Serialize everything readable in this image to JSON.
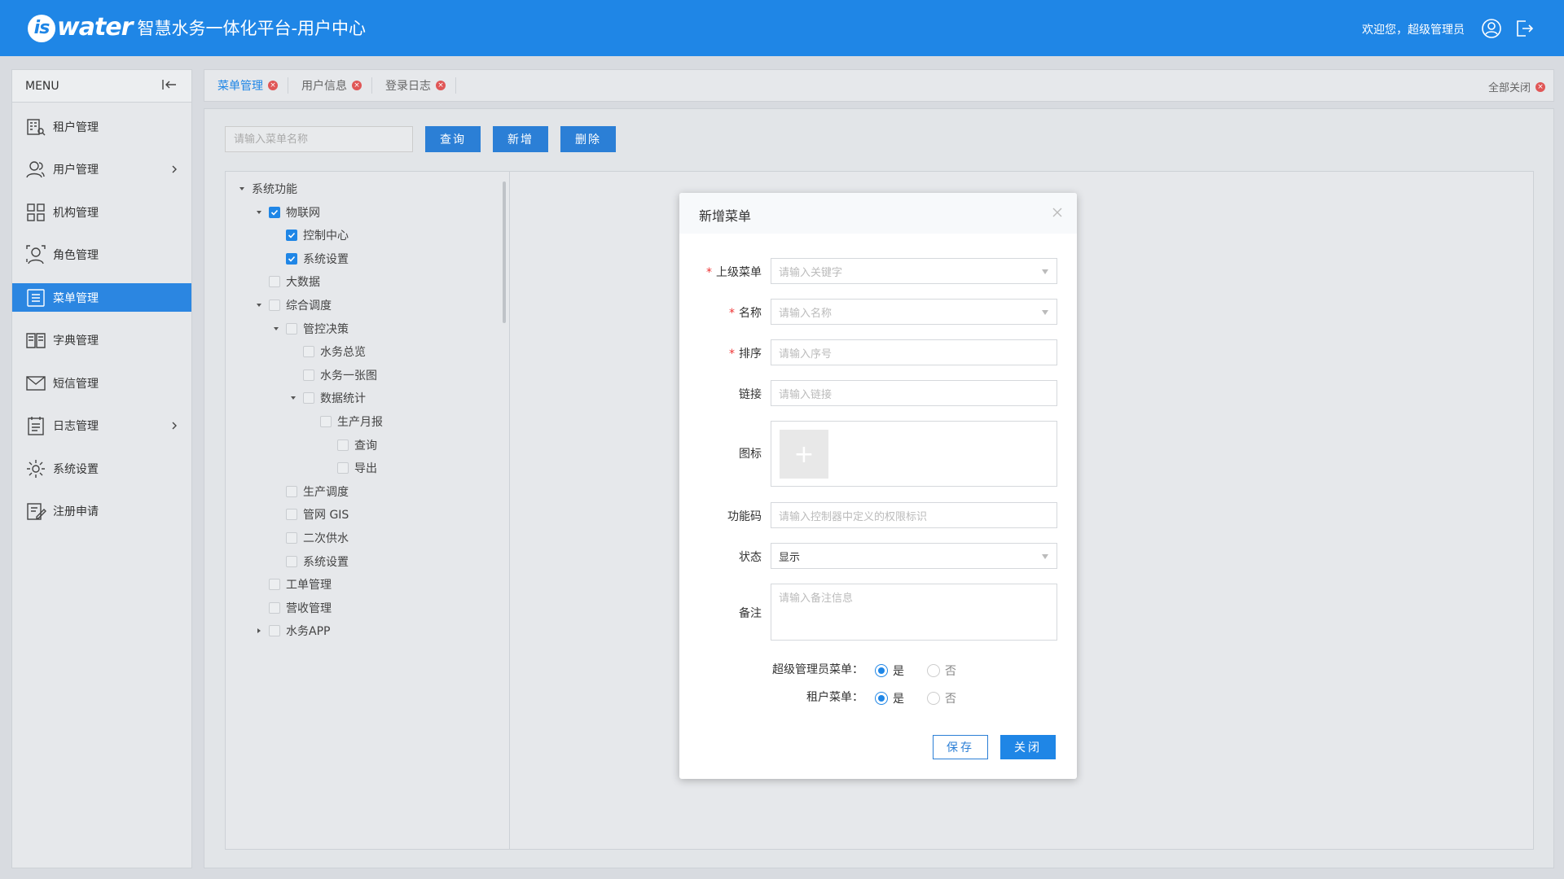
{
  "header": {
    "logo_prefix": "is",
    "logo_word": "water",
    "app_title": "智慧水务一体化平台-用户中心",
    "welcome": "欢迎您，超级管理员"
  },
  "sidebar": {
    "title": "MENU",
    "items": [
      {
        "label": "租户管理",
        "icon": "tenant-icon",
        "active": false,
        "expandable": false
      },
      {
        "label": "用户管理",
        "icon": "users-icon",
        "active": false,
        "expandable": true
      },
      {
        "label": "机构管理",
        "icon": "org-icon",
        "active": false,
        "expandable": false
      },
      {
        "label": "角色管理",
        "icon": "role-icon",
        "active": false,
        "expandable": false
      },
      {
        "label": "菜单管理",
        "icon": "menu-icon",
        "active": true,
        "expandable": false
      },
      {
        "label": "字典管理",
        "icon": "dictionary-icon",
        "active": false,
        "expandable": false
      },
      {
        "label": "短信管理",
        "icon": "sms-icon",
        "active": false,
        "expandable": false
      },
      {
        "label": "日志管理",
        "icon": "log-icon",
        "active": false,
        "expandable": true
      },
      {
        "label": "系统设置",
        "icon": "settings-icon",
        "active": false,
        "expandable": false
      },
      {
        "label": "注册申请",
        "icon": "register-icon",
        "active": false,
        "expandable": false
      }
    ]
  },
  "tabs": {
    "items": [
      {
        "label": "菜单管理",
        "active": true
      },
      {
        "label": "用户信息",
        "active": false
      },
      {
        "label": "登录日志",
        "active": false
      }
    ],
    "close_all": "全部关闭"
  },
  "toolbar": {
    "search_placeholder": "请输入菜单名称",
    "query": "查询",
    "add": "新增",
    "delete": "删除"
  },
  "tree": [
    {
      "label": "系统功能",
      "level": 0,
      "caret": "down",
      "checkbox": false,
      "checked": false
    },
    {
      "label": "物联网",
      "level": 1,
      "caret": "down",
      "checkbox": true,
      "checked": true
    },
    {
      "label": "控制中心",
      "level": 2,
      "caret": "none",
      "checkbox": true,
      "checked": true
    },
    {
      "label": "系统设置",
      "level": 2,
      "caret": "none",
      "checkbox": true,
      "checked": true
    },
    {
      "label": "大数据",
      "level": 1,
      "caret": "none",
      "checkbox": true,
      "checked": false
    },
    {
      "label": "综合调度",
      "level": 1,
      "caret": "down",
      "checkbox": true,
      "checked": false
    },
    {
      "label": "管控决策",
      "level": 2,
      "caret": "down",
      "checkbox": true,
      "checked": false
    },
    {
      "label": "水务总览",
      "level": 3,
      "caret": "none",
      "checkbox": true,
      "checked": false
    },
    {
      "label": "水务一张图",
      "level": 3,
      "caret": "none",
      "checkbox": true,
      "checked": false
    },
    {
      "label": "数据统计",
      "level": 3,
      "caret": "down",
      "checkbox": true,
      "checked": false
    },
    {
      "label": "生产月报",
      "level": 4,
      "caret": "none",
      "checkbox": true,
      "checked": false
    },
    {
      "label": "查询",
      "level": 5,
      "caret": "none",
      "checkbox": true,
      "checked": false
    },
    {
      "label": "导出",
      "level": 5,
      "caret": "none",
      "checkbox": true,
      "checked": false
    },
    {
      "label": "生产调度",
      "level": 2,
      "caret": "none",
      "checkbox": true,
      "checked": false
    },
    {
      "label": "管网 GIS",
      "level": 2,
      "caret": "none",
      "checkbox": true,
      "checked": false
    },
    {
      "label": "二次供水",
      "level": 2,
      "caret": "none",
      "checkbox": true,
      "checked": false
    },
    {
      "label": "系统设置",
      "level": 2,
      "caret": "none",
      "checkbox": true,
      "checked": false
    },
    {
      "label": "工单管理",
      "level": 1,
      "caret": "none",
      "checkbox": true,
      "checked": false
    },
    {
      "label": "营收管理",
      "level": 1,
      "caret": "none",
      "checkbox": true,
      "checked": false
    },
    {
      "label": "水务APP",
      "level": 1,
      "caret": "right",
      "checkbox": true,
      "checked": false
    }
  ],
  "modal": {
    "title": "新增菜单",
    "fields": {
      "parent": {
        "label": "上级菜单",
        "placeholder": "请输入关键字",
        "required": true
      },
      "name": {
        "label": "名称",
        "placeholder": "请输入名称",
        "required": true
      },
      "sort": {
        "label": "排序",
        "placeholder": "请输入序号",
        "required": true
      },
      "link": {
        "label": "链接",
        "placeholder": "请输入链接",
        "required": false
      },
      "icon": {
        "label": "图标",
        "add_symbol": "+"
      },
      "code": {
        "label": "功能码",
        "placeholder": "请输入控制器中定义的权限标识",
        "required": false
      },
      "status": {
        "label": "状态",
        "value": "显示",
        "required": false
      },
      "remark": {
        "label": "备注",
        "placeholder": "请输入备注信息",
        "required": false
      }
    },
    "radios": {
      "super_admin": {
        "label": "超级管理员菜单：",
        "yes": "是",
        "no": "否",
        "selected": "yes"
      },
      "tenant": {
        "label": "租户菜单：",
        "yes": "是",
        "no": "否",
        "selected": "yes"
      }
    },
    "save": "保存",
    "close": "关闭"
  },
  "colors": {
    "primary": "#1f86e6",
    "button": "#2b7fd6",
    "danger": "#e05656",
    "required": "#ee3333"
  }
}
